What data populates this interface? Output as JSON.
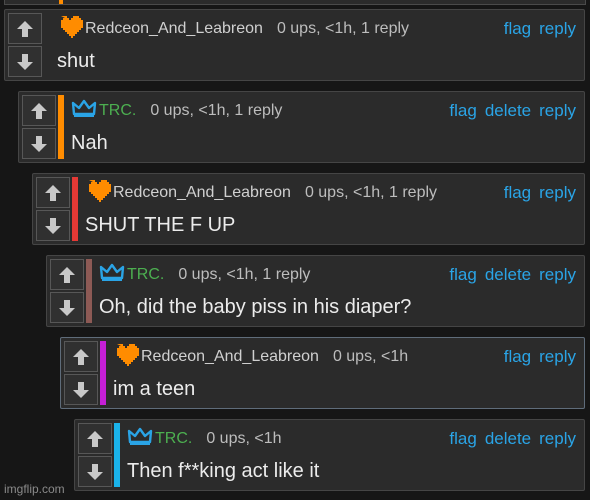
{
  "colors": {
    "background": "#161616",
    "panel": "#2b2b2b",
    "link": "#2aa4e6",
    "mod_username": "#4caf50"
  },
  "comments": [
    {
      "depth": 0,
      "avatar": "orange-heart-icon",
      "username": "Redceon_And_Leabreon",
      "mod": false,
      "meta": "0 ups, <1h, 1 reply",
      "actions": [
        "flag",
        "reply"
      ],
      "text": "shut",
      "bar_color": "",
      "highlighted": false
    },
    {
      "depth": 1,
      "avatar": "blue-crown-icon",
      "username": "TRC.",
      "mod": true,
      "meta": "0 ups, <1h, 1 reply",
      "actions": [
        "flag",
        "delete",
        "reply"
      ],
      "text": "Nah",
      "bar_color": "#ff8c00",
      "highlighted": false
    },
    {
      "depth": 2,
      "avatar": "orange-heart-icon",
      "username": "Redceon_And_Leabreon",
      "mod": false,
      "meta": "0 ups, <1h, 1 reply",
      "actions": [
        "flag",
        "reply"
      ],
      "text": "SHUT THE F UP",
      "bar_color": "#e53935",
      "highlighted": false
    },
    {
      "depth": 3,
      "avatar": "blue-crown-icon",
      "username": "TRC.",
      "mod": true,
      "meta": "0 ups, <1h, 1 reply",
      "actions": [
        "flag",
        "delete",
        "reply"
      ],
      "text": "Oh, did the baby piss in his diaper?",
      "bar_color": "#8d5a55",
      "highlighted": false
    },
    {
      "depth": 4,
      "avatar": "orange-heart-icon",
      "username": "Redceon_And_Leabreon",
      "mod": false,
      "meta": "0 ups, <1h",
      "actions": [
        "flag",
        "reply"
      ],
      "text": "im a teen",
      "bar_color": "#c51fd6",
      "highlighted": true
    },
    {
      "depth": 5,
      "avatar": "blue-crown-icon",
      "username": "TRC.",
      "mod": true,
      "meta": "0 ups, <1h",
      "actions": [
        "flag",
        "delete",
        "reply"
      ],
      "text": "Then f**king act like it",
      "bar_color": "#1ab3ea",
      "highlighted": false
    }
  ],
  "watermark": "imgflip.com"
}
